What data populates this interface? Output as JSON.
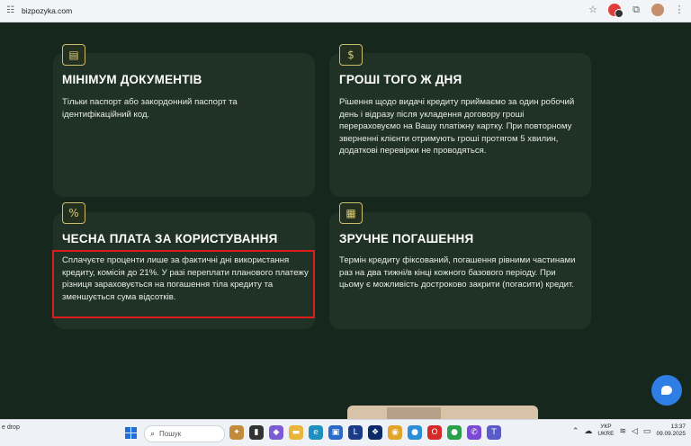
{
  "browser": {
    "url": "bizpozyka.com"
  },
  "cards": [
    {
      "title": "МІНІМУМ ДОКУМЕНТІВ",
      "text": "Тільки паспорт або закордонний паспорт та ідентифікаційний код.",
      "icon": "document-icon"
    },
    {
      "title": "ГРОШІ ТОГО Ж ДНЯ",
      "text": "Рішення щодо видачі кредиту приймаємо за один робочий день і відразу після укладення договору гроші перераховуємо на Вашу платіжну картку. При повторному зверненні клієнти отримують гроші протягом 5 хвилин, додаткові перевірки не проводяться.",
      "icon": "money-icon"
    },
    {
      "title": "ЧЕСНА ПЛАТА ЗА КОРИСТУВАННЯ",
      "text": "Сплачуєте проценти лише за фактичні дні використання кредиту, комісія до 21%. У разі переплати планового платежу різниця зараховується на погашення тіла кредиту та зменшується сума відсотків.",
      "icon": "percent-icon"
    },
    {
      "title": "ЗРУЧНЕ ПОГАШЕННЯ",
      "text": "Термін кредиту фіксований, погашення рівними частинами раз на два тижні/в кінці кожного базового періоду. При цьому є можливість достроково закрити (погасити) кредит.",
      "icon": "calendar-icon"
    }
  ],
  "taskbar": {
    "left_text": "e drop",
    "search_placeholder": "Пошук",
    "lang_top": "УКР",
    "lang_bottom": "UKRE",
    "time": "13:37",
    "date": "09.09.2025"
  },
  "colors": {
    "page_bg": "#16271d",
    "card_bg": "#203126",
    "highlight": "#e01b1b",
    "chat_button": "#2f7ee6"
  }
}
